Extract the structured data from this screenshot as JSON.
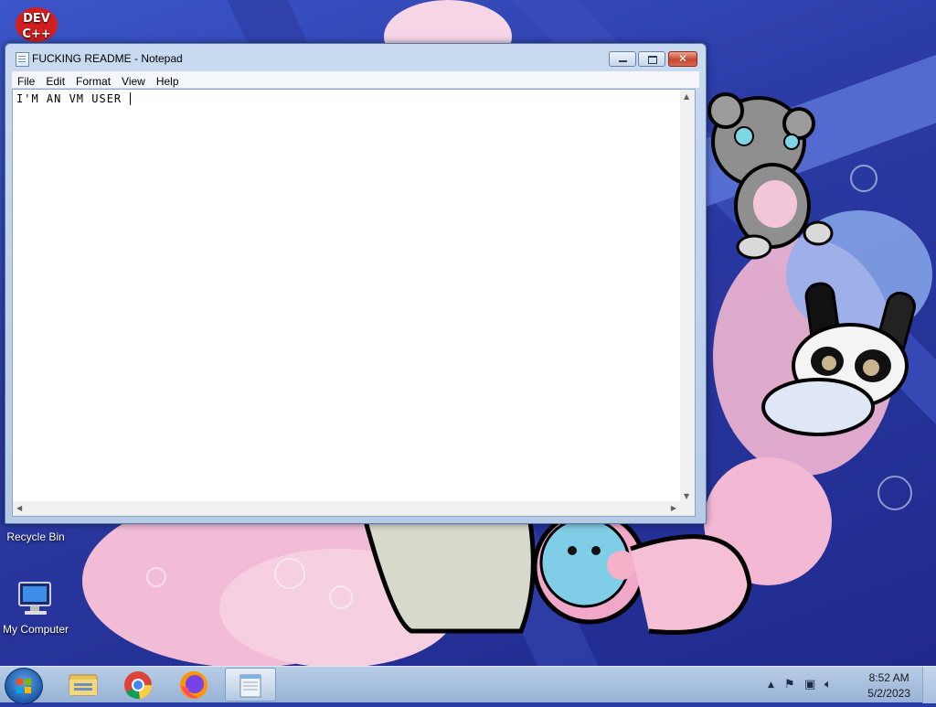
{
  "desktop": {
    "icons": [
      {
        "name": "dev-cpp",
        "label": "",
        "logo_text": "DEV C++"
      },
      {
        "name": "recycle-bin",
        "label": "Recycle Bin"
      },
      {
        "name": "my-computer",
        "label": "My Computer"
      }
    ]
  },
  "notepad": {
    "title": "FUCKING README - Notepad",
    "menu": [
      "File",
      "Edit",
      "Format",
      "View",
      "Help"
    ],
    "content": "I'M AN VM USER "
  },
  "taskbar": {
    "apps": [
      "file-explorer",
      "google-chrome",
      "firefox",
      "notepad"
    ],
    "active_app": "notepad",
    "clock": {
      "time": "8:52 AM",
      "date": "5/2/2023"
    }
  },
  "colors": {
    "desktop_bg": "#2a3aa8",
    "window_frame": "#b6cbe6",
    "close_button": "#c8452c",
    "taskbar": "#97b3d6"
  }
}
